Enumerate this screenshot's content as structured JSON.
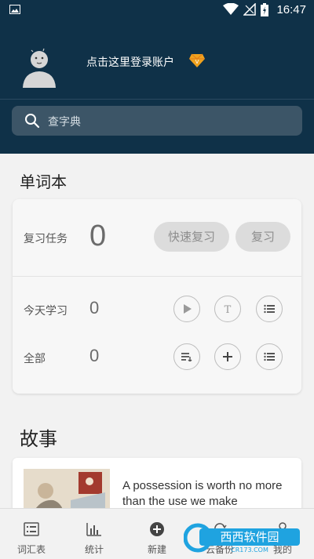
{
  "status_bar": {
    "time": "16:47"
  },
  "header": {
    "login_text": "点击这里登录账户",
    "search_placeholder": "查字典"
  },
  "wordbook": {
    "title": "单词本",
    "review_task_label": "复习任务",
    "review_task_count": "0",
    "quick_review_label": "快速复习",
    "review_label": "复习",
    "today_label": "今天学习",
    "today_count": "0",
    "all_label": "全部",
    "all_count": "0"
  },
  "story": {
    "title": "故事",
    "card_text": "A possession is worth no more than the use we make"
  },
  "bottom_nav": {
    "items": [
      {
        "label": "词汇表",
        "icon": "list-icon"
      },
      {
        "label": "统计",
        "icon": "chart-icon"
      },
      {
        "label": "新建",
        "icon": "add-circle-icon"
      },
      {
        "label": "云备份",
        "icon": "cloud-sync-icon"
      },
      {
        "label": "我的",
        "icon": "person-icon"
      }
    ]
  },
  "watermark": {
    "text": "西西软件园",
    "url_text": "CR173.COM"
  },
  "colors": {
    "header_bg": "#0f3148",
    "search_bg": "#3c5567",
    "accent": "#e07b1a"
  }
}
